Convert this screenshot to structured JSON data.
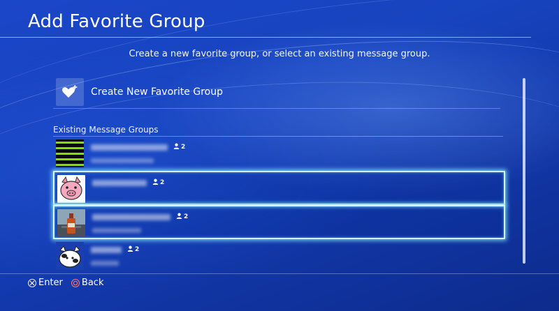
{
  "header": {
    "title": "Add Favorite Group",
    "subtitle": "Create a new favorite group, or select an existing message group."
  },
  "create": {
    "label": "Create New Favorite Group",
    "icon": "heart-plus-icon"
  },
  "section": {
    "label": "Existing Message Groups"
  },
  "groups": [
    {
      "avatar": "striped-avatar",
      "members": "2",
      "highlighted": false
    },
    {
      "avatar": "pig-avatar",
      "members": "2",
      "highlighted": true
    },
    {
      "avatar": "bottle-photo-avatar",
      "members": "2",
      "highlighted": true
    },
    {
      "avatar": "cow-avatar",
      "members": "2",
      "highlighted": false
    }
  ],
  "footer": {
    "enter_label": "Enter",
    "back_label": "Back",
    "enter_icon": "cross-button-icon",
    "back_icon": "circle-button-icon"
  },
  "colors": {
    "background": "#1744bf",
    "highlight": "#d8f6ff",
    "stripe_green": "#7fe000",
    "pig_pink": "#f5a9c0"
  }
}
